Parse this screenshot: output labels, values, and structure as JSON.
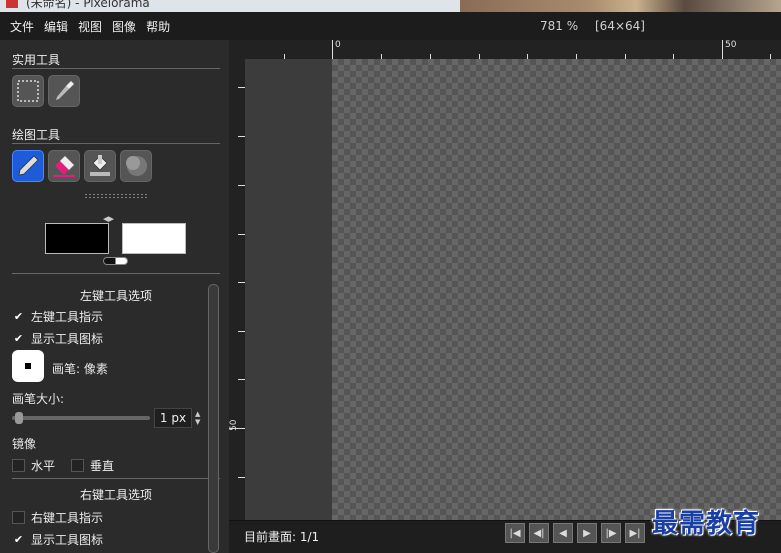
{
  "window": {
    "title": "(未命名) - Pixelorama"
  },
  "menu": [
    "文件",
    "编辑",
    "视图",
    "图像",
    "帮助"
  ],
  "topbar": {
    "zoom": "781 %",
    "dims": "[64×64]"
  },
  "panel": {
    "utility_title": "实用工具",
    "draw_title": "绘图工具",
    "left_options_title": "左键工具选项",
    "left_indicator": "左键工具指示",
    "show_icon": "显示工具图标",
    "brush_label": "画笔: 像素",
    "brush_size_label": "画笔大小:",
    "brush_size_value": "1 px",
    "mirror_label": "镜像",
    "mirror_h": "水平",
    "mirror_v": "垂直",
    "right_options_title": "右键工具选项",
    "right_indicator": "右键工具指示",
    "right_show_icon": "显示工具图标"
  },
  "colors": {
    "primary": "#000000",
    "secondary": "#ffffff",
    "accent_left": "#1e5bd8",
    "accent_right": "#e0207a"
  },
  "ruler": {
    "top_labels": [
      "0",
      "50"
    ],
    "left_labels": [
      "50"
    ]
  },
  "status": {
    "frame": "目前畫面: 1/1"
  },
  "watermark": "最需教育",
  "icons": [
    "rect-select-icon",
    "color-picker-icon",
    "pencil-icon",
    "eraser-icon",
    "bucket-icon",
    "shading-icon"
  ]
}
